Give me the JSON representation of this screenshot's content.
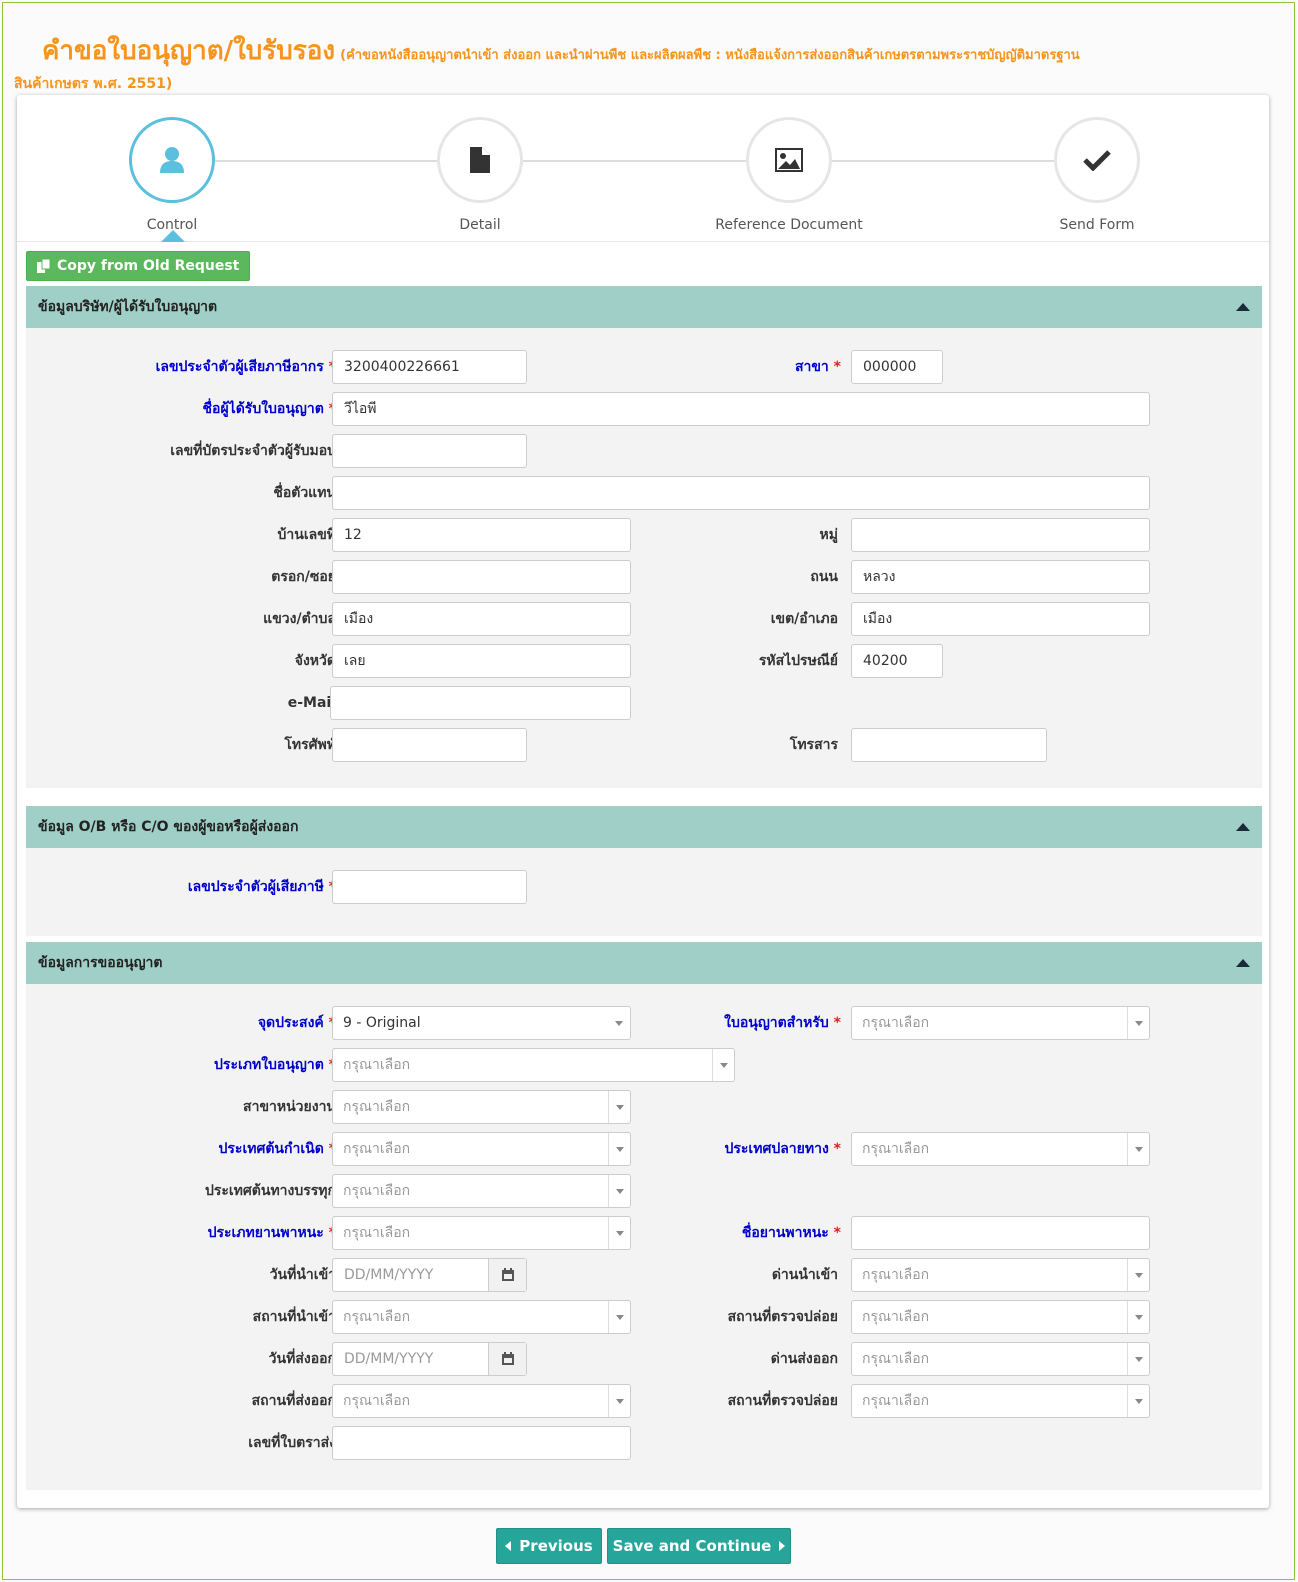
{
  "header": {
    "title": "คำขอใบอนุญาต/ใบรับรอง",
    "subtitle_part1": "(คำขอหนังสืออนุญาตนำเข้า ส่งออก และนำผ่านพืช และผลิตผลพืช : หนังสือแจ้งการส่งออกสินค้าเกษตรตามพระราชบัญญัติมาตรฐาน",
    "subtitle_part2": "สินค้าเกษตร พ.ศ. 2551)"
  },
  "wizard": {
    "steps": [
      {
        "label": "Control",
        "icon": "user-icon",
        "active": true
      },
      {
        "label": "Detail",
        "icon": "file-icon",
        "active": false
      },
      {
        "label": "Reference Document",
        "icon": "image-icon",
        "active": false
      },
      {
        "label": "Send Form",
        "icon": "check-icon",
        "active": false
      }
    ]
  },
  "copy_button": "Copy from Old Request",
  "sections": {
    "company": {
      "title": "ข้อมูลบริษัท/ผู้ได้รับใบอนุญาต",
      "tax_id_label": "เลขประจำตัวผู้เสียภาษีอากร",
      "tax_id_value": "3200400226661",
      "branch_label": "สาขา",
      "branch_value": "000000",
      "licensee_label": "ชื่อผู้ได้รับใบอนุญาต",
      "licensee_value": "วีไอพี",
      "id_card_label": "เลขที่บัตรประจำตัวผู้รับมอบ",
      "id_card_value": "",
      "agent_label": "ชื่อตัวแทน",
      "agent_value": "",
      "house_no_label": "บ้านเลขที่",
      "house_no_value": "12",
      "moo_label": "หมู่",
      "moo_value": "",
      "soi_label": "ตรอก/ซอย",
      "soi_value": "",
      "road_label": "ถนน",
      "road_value": "หลวง",
      "subdistrict_label": "แขวง/ตำบล",
      "subdistrict_value": "เมือง",
      "district_label": "เขต/อำเภอ",
      "district_value": "เมือง",
      "province_label": "จังหวัด",
      "province_value": "เลย",
      "postcode_label": "รหัสไปรษณีย์",
      "postcode_value": "40200",
      "email_label": "e-Mail",
      "email_value": "",
      "phone_label": "โทรศัพท์",
      "phone_value": "",
      "fax_label": "โทรสาร",
      "fax_value": ""
    },
    "ob_co": {
      "title": "ข้อมูล O/B หรือ C/O ของผู้ขอหรือผู้ส่งออก",
      "tax_label": "เลขประจำตัวผู้เสียภาษี",
      "tax_value": ""
    },
    "permit": {
      "title": "ข้อมูลการขออนุญาต",
      "purpose_label": "จุดประสงค์",
      "purpose_value": "9 - Original",
      "license_for_label": "ใบอนุญาตสำหรับ",
      "license_type_label": "ประเภทใบอนุญาต",
      "branch_unit_label": "สาขาหน่วยงาน",
      "origin_country_label": "ประเทศต้นกำเนิด",
      "dest_country_label": "ประเทศปลายทาง",
      "loading_country_label": "ประเทศต้นทางบรรทุก",
      "vehicle_type_label": "ประเภทยานพาหนะ",
      "vehicle_name_label": "ชื่อยานพาหนะ",
      "vehicle_name_value": "",
      "import_date_label": "วันที่นำเข้า",
      "import_port_label": "ด่านนำเข้า",
      "import_place_label": "สถานที่นำเข้า",
      "inspect_place_label": "สถานที่ตรวจปล่อย",
      "export_date_label": "วันที่ส่งออก",
      "export_port_label": "ด่านส่งออก",
      "export_place_label": "สถานที่ส่งออก",
      "inspect_place2_label": "สถานที่ตรวจปล่อย",
      "waybill_label": "เลขที่ใบตราส่ง",
      "waybill_value": "",
      "select_placeholder": "กรุณาเลือก",
      "date_placeholder": "DD/MM/YYYY"
    }
  },
  "required_mark": "*",
  "nav": {
    "previous": "Previous",
    "save_continue": "Save and Continue"
  },
  "colors": {
    "accent_orange": "#f7941d",
    "section_header": "#9fcfc6",
    "required_label": "#0000cc",
    "button_teal": "#26a69a",
    "button_green": "#5cb85c",
    "active_step": "#5bc0de"
  }
}
